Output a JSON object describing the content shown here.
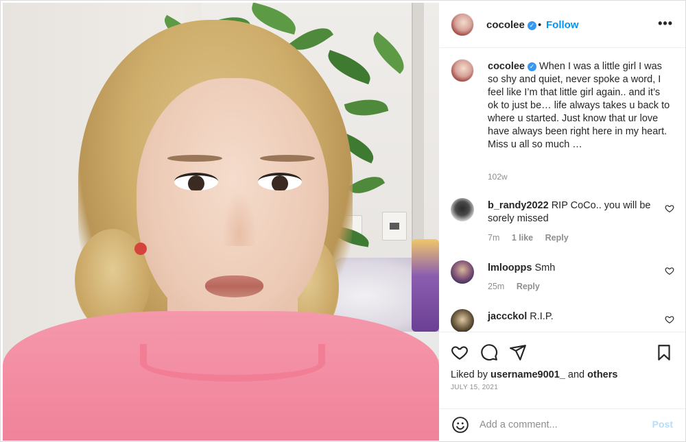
{
  "post": {
    "username": "cocolee",
    "verified": true,
    "header_dot": "•",
    "follow_label": "Follow",
    "more_label": "•••"
  },
  "caption": {
    "username": "cocolee",
    "text": "When I was a little girl I was so shy and quiet, never spoke a word, I feel like I’m that little girl again.. and it’s ok to just be… life always takes u back to where u started. Just know that ur love have always been right here in my heart. Miss u all so much …",
    "time": "102w"
  },
  "comments": [
    {
      "username": "b_randy2022",
      "text": "RIP CoCo.. you will be sorely missed",
      "time": "7m",
      "likes": "1 like",
      "reply": "Reply",
      "avatar_color": "#6b6b6b"
    },
    {
      "username": "lmloopps",
      "text": "Smh",
      "time": "25m",
      "reply": "Reply",
      "avatar_color": "#4a3b5c"
    },
    {
      "username": "jaccckol",
      "text": "R.I.P.",
      "avatar_color": "#5a4b3a"
    }
  ],
  "likes": {
    "prefix": "Liked by",
    "user": "username9001_",
    "and": "and",
    "others": "others"
  },
  "date": "JULY 15, 2021",
  "add_comment": {
    "placeholder": "Add a comment...",
    "post_label": "Post"
  },
  "colors": {
    "link_blue": "#0095f6",
    "verified_blue": "#3897f0",
    "muted": "#8e8e8e",
    "post_disabled": "#b2dffc"
  },
  "icons": [
    "heart-icon",
    "comment-icon",
    "share-icon",
    "bookmark-icon",
    "emoji-icon",
    "more-icon",
    "verified-icon"
  ]
}
